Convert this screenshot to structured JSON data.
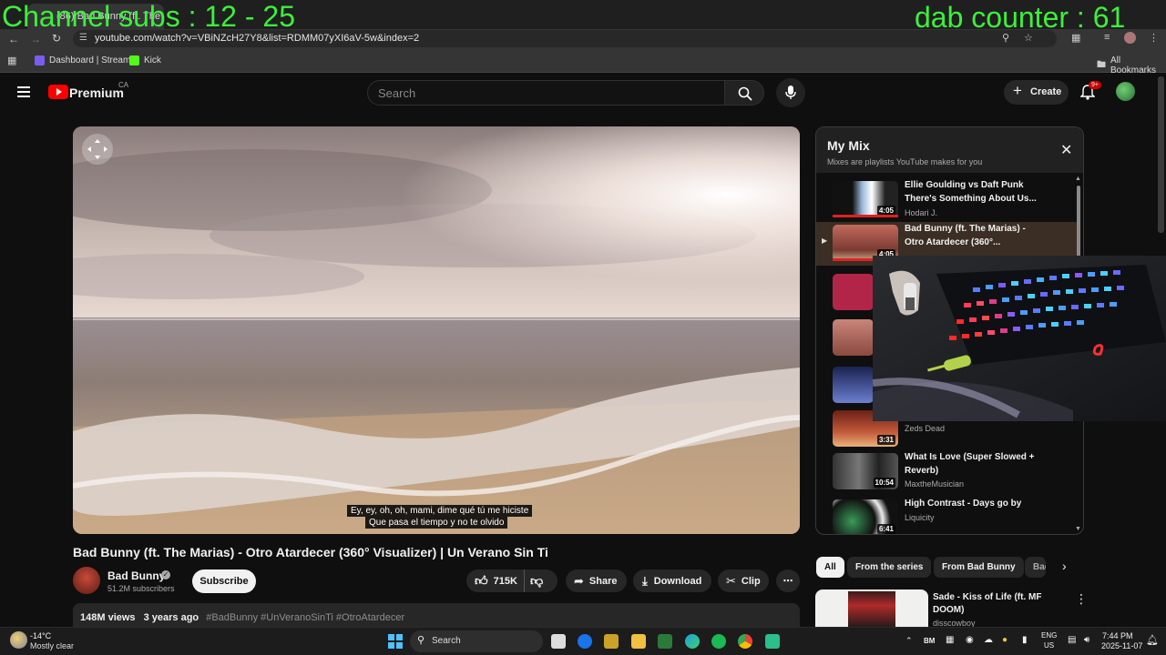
{
  "overlay": {
    "left_text": "Channel subs : 12 - 25",
    "right_text": "dab counter : 61"
  },
  "browser": {
    "tab_title": "(86) Bad Bunny (ft. The Mar...",
    "url": "youtube.com/watch?v=VBiNZcH27Y8&list=RDMM07yXI6aV-5w&index=2",
    "bookmarks": [
      "Dashboard | Stream...",
      "Kick"
    ],
    "all_bookmarks": "All Bookmarks"
  },
  "youtube": {
    "logo_text": "Premium",
    "region": "CA",
    "search_placeholder": "Search",
    "create_label": "Create",
    "notif_badge": "9+"
  },
  "video": {
    "subtitle_line1": "Ey, ey, oh, oh, mami, dime qué tú me hiciste",
    "subtitle_line2": "Que pasa el tiempo y no te olvido",
    "title": "Bad Bunny (ft. The Marias) - Otro Atardecer (360° Visualizer) | Un Verano Sin Ti",
    "channel": "Bad Bunny",
    "subscribers": "51.2M subscribers",
    "subscribe_label": "Subscribe",
    "likes": "715K",
    "share_label": "Share",
    "download_label": "Download",
    "clip_label": "Clip",
    "views": "148M views",
    "age": "3 years ago",
    "hashtags": "#BadBunny #UnVeranoSinTi #OtroAtardecer"
  },
  "mix": {
    "title": "My Mix",
    "subtitle": "Mixes are playlists YouTube makes for you",
    "items": [
      {
        "title": "Ellie Goulding vs Daft Punk There's Something About Us...",
        "channel": "Hodari J.",
        "duration": "4:05"
      },
      {
        "title": "Bad Bunny (ft. The Marias) - Otro Atardecer (360°...",
        "channel": "",
        "duration": "4:05"
      },
      {
        "title": "",
        "channel": "Zeds Dead",
        "duration": "3:31"
      },
      {
        "title": "What Is Love (Super Slowed + Reverb)",
        "channel": "MaxtheMusician",
        "duration": "10:54"
      },
      {
        "title": "High Contrast - Days go by",
        "channel": "Liquicity",
        "duration": "6:41"
      }
    ]
  },
  "chips": [
    "All",
    "From the series",
    "From Bad Bunny",
    "Bad"
  ],
  "related": {
    "title": "Sade - Kiss of Life (ft. MF DOOM)",
    "channel": "disscowboy"
  },
  "taskbar": {
    "temp": "-14°C",
    "weather": "Mostly clear",
    "search": "Search",
    "lang1": "ENG",
    "lang2": "US",
    "time": "7:44 PM",
    "date": "2025-11-07",
    "bm": "BM"
  },
  "colors": {
    "overlay_green": "#3cf03c",
    "yt_red": "#ff0000",
    "bg": "#0f0f0f"
  }
}
